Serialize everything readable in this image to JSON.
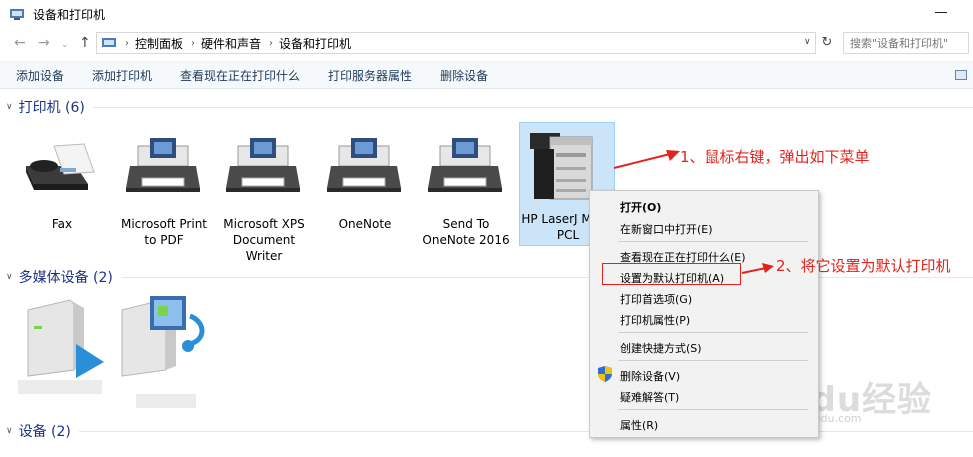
{
  "window": {
    "title": "设备和打印机"
  },
  "address": {
    "crumbs": [
      "控制面板",
      "硬件和声音",
      "设备和打印机"
    ],
    "search_placeholder": "搜索\"设备和打印机\""
  },
  "toolbar": {
    "items": [
      "添加设备",
      "添加打印机",
      "查看现在正在打印什么",
      "打印服务器属性",
      "删除设备"
    ]
  },
  "groups": {
    "printers": "打印机 (6)",
    "media": "多媒体设备 (2)",
    "devices": "设备 (2)"
  },
  "printers": [
    {
      "label": "Fax",
      "icon": "fax-icon"
    },
    {
      "label": "Microsoft Print to PDF",
      "icon": "printer-icon"
    },
    {
      "label": "Microsoft XPS Document Writer",
      "icon": "printer-icon"
    },
    {
      "label": "OneNote",
      "icon": "printer-icon"
    },
    {
      "label": "Send To OneNote 2016",
      "icon": "printer-icon"
    },
    {
      "label": "HP LaserJ M806 PCL",
      "icon": "laser-printer-icon"
    }
  ],
  "context_menu": {
    "items": {
      "open": "打开(O)",
      "open_new_window": "在新窗口中打开(E)",
      "see_printing": "查看现在正在打印什么(E)",
      "set_default": "设置为默认打印机(A)",
      "preferences": "打印首选项(G)",
      "printer_props": "打印机属性(P)",
      "create_shortcut": "创建快捷方式(S)",
      "remove_device": "删除设备(V)",
      "troubleshoot": "疑难解答(T)",
      "properties": "属性(R)"
    }
  },
  "annotations": {
    "step1": "1、鼠标右键，弹出如下菜单",
    "step2": "2、将它设置为默认打印机"
  },
  "watermark": {
    "brand": "Baidu经验",
    "site": "jingyan.baidu.com"
  },
  "colors": {
    "annotation_red": "#e2231a",
    "group_title": "#1e3287",
    "command_text": "#1e395b",
    "selection": "#cce4f7"
  }
}
